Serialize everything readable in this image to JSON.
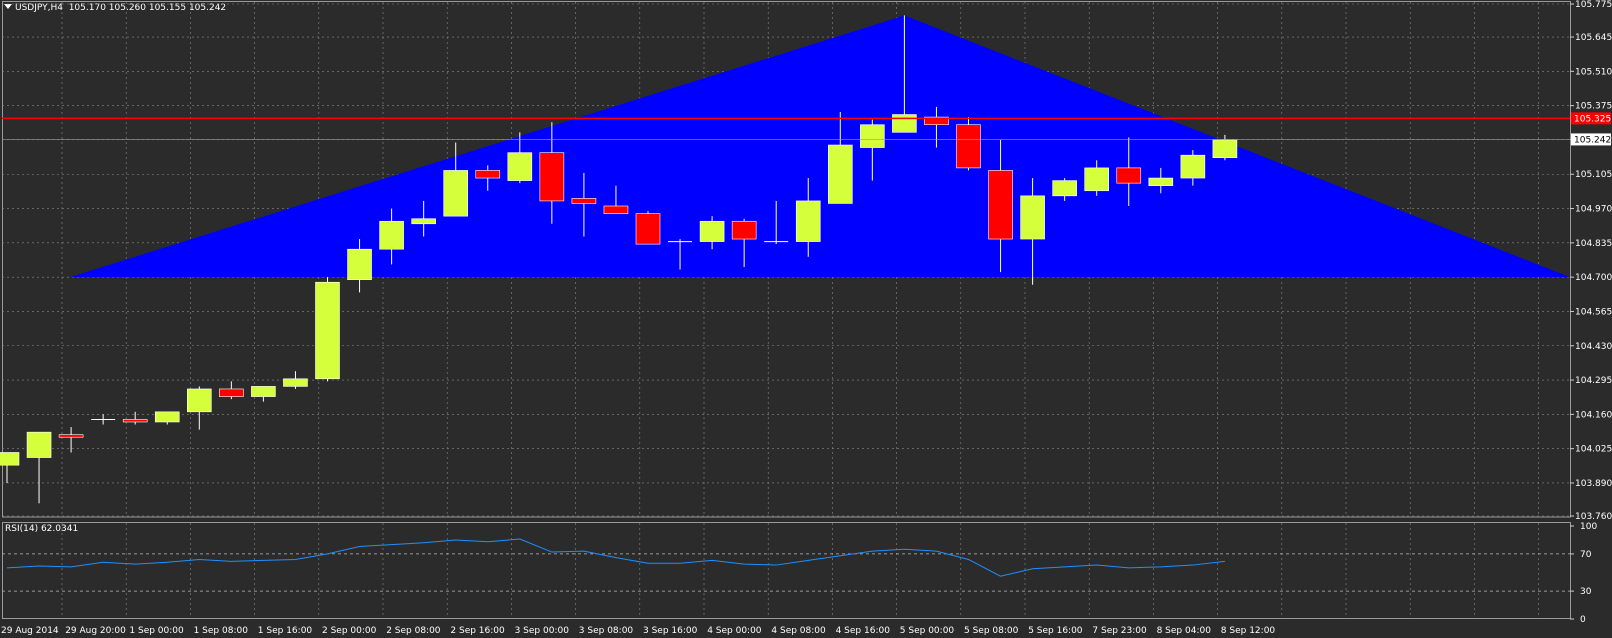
{
  "header": {
    "symbol": "USDJPY,H4",
    "ohlc": "105.170 105.260 105.155 105.242"
  },
  "rsi_header": {
    "label": "RSI(14) 62.0341"
  },
  "colors": {
    "background": "#2b2b2b",
    "grid": "#8a8a8a",
    "bull_candle": "#d4ff3a",
    "bear_candle": "#ff0000",
    "wick": "#ffffff",
    "triangle": "#0000ff",
    "hline": "#ff0000",
    "rsi_line": "#1e90ff",
    "current_price_box": "#ffffff"
  },
  "chart_data": [
    {
      "type": "candlestick",
      "title": "USDJPY,H4",
      "x": [
        "29 Aug 2014",
        "29 Aug 20:00",
        "1 Sep 00:00",
        "1 Sep 08:00",
        "1 Sep 16:00",
        "2 Sep 00:00",
        "2 Sep 08:00",
        "2 Sep 16:00",
        "3 Sep 00:00",
        "3 Sep 08:00",
        "3 Sep 16:00",
        "4 Sep 00:00",
        "4 Sep 08:00",
        "4 Sep 16:00",
        "5 Sep 00:00",
        "5 Sep 08:00",
        "5 Sep 16:00",
        "7 Sep 23:00",
        "8 Sep 04:00",
        "8 Sep 12:00"
      ],
      "y_ticks": [
        "105.775",
        "105.645",
        "105.510",
        "105.375",
        "105.242",
        "105.105",
        "104.970",
        "104.835",
        "104.700",
        "104.565",
        "104.430",
        "104.295",
        "104.160",
        "104.025",
        "103.890",
        "103.760"
      ],
      "ylim": [
        103.76,
        105.775
      ],
      "grid": true,
      "candles": [
        {
          "o": 103.96,
          "h": 103.99,
          "l": 103.89,
          "c": 104.01
        },
        {
          "o": 103.99,
          "h": 104.09,
          "l": 103.81,
          "c": 104.09
        },
        {
          "o": 104.08,
          "h": 104.11,
          "l": 104.01,
          "c": 104.07
        },
        {
          "o": 104.14,
          "h": 104.16,
          "l": 104.12,
          "c": 104.14
        },
        {
          "o": 104.14,
          "h": 104.17,
          "l": 104.12,
          "c": 104.13
        },
        {
          "o": 104.13,
          "h": 104.17,
          "l": 104.12,
          "c": 104.17
        },
        {
          "o": 104.17,
          "h": 104.27,
          "l": 104.1,
          "c": 104.26
        },
        {
          "o": 104.26,
          "h": 104.29,
          "l": 104.22,
          "c": 104.23
        },
        {
          "o": 104.23,
          "h": 104.27,
          "l": 104.21,
          "c": 104.27
        },
        {
          "o": 104.27,
          "h": 104.33,
          "l": 104.26,
          "c": 104.3
        },
        {
          "o": 104.3,
          "h": 104.7,
          "l": 104.29,
          "c": 104.68
        },
        {
          "o": 104.69,
          "h": 104.85,
          "l": 104.64,
          "c": 104.81
        },
        {
          "o": 104.81,
          "h": 104.97,
          "l": 104.75,
          "c": 104.92
        },
        {
          "o": 104.91,
          "h": 105.0,
          "l": 104.86,
          "c": 104.93
        },
        {
          "o": 104.94,
          "h": 105.23,
          "l": 104.94,
          "c": 105.12
        },
        {
          "o": 105.12,
          "h": 105.14,
          "l": 105.04,
          "c": 105.09
        },
        {
          "o": 105.08,
          "h": 105.27,
          "l": 105.07,
          "c": 105.19
        },
        {
          "o": 105.19,
          "h": 105.31,
          "l": 104.91,
          "c": 105.0
        },
        {
          "o": 105.01,
          "h": 105.11,
          "l": 104.86,
          "c": 104.99
        },
        {
          "o": 104.98,
          "h": 105.06,
          "l": 104.95,
          "c": 104.95
        },
        {
          "o": 104.95,
          "h": 104.96,
          "l": 104.84,
          "c": 104.83
        },
        {
          "o": 104.84,
          "h": 104.85,
          "l": 104.73,
          "c": 104.84
        },
        {
          "o": 104.84,
          "h": 104.94,
          "l": 104.81,
          "c": 104.92
        },
        {
          "o": 104.92,
          "h": 104.93,
          "l": 104.74,
          "c": 104.85
        },
        {
          "o": 104.84,
          "h": 105.0,
          "l": 104.83,
          "c": 104.84
        },
        {
          "o": 104.84,
          "h": 105.09,
          "l": 104.78,
          "c": 105.0
        },
        {
          "o": 104.99,
          "h": 105.35,
          "l": 104.99,
          "c": 105.22
        },
        {
          "o": 105.21,
          "h": 105.32,
          "l": 105.08,
          "c": 105.3
        },
        {
          "o": 105.27,
          "h": 105.73,
          "l": 105.27,
          "c": 105.34
        },
        {
          "o": 105.33,
          "h": 105.37,
          "l": 105.21,
          "c": 105.3
        },
        {
          "o": 105.3,
          "h": 105.33,
          "l": 105.12,
          "c": 105.13
        },
        {
          "o": 105.12,
          "h": 105.24,
          "l": 104.72,
          "c": 104.85
        },
        {
          "o": 104.85,
          "h": 105.09,
          "l": 104.67,
          "c": 105.02
        },
        {
          "o": 105.02,
          "h": 105.09,
          "l": 105.0,
          "c": 105.08
        },
        {
          "o": 105.04,
          "h": 105.16,
          "l": 105.02,
          "c": 105.13
        },
        {
          "o": 105.13,
          "h": 105.25,
          "l": 104.98,
          "c": 105.07
        },
        {
          "o": 105.06,
          "h": 105.13,
          "l": 105.03,
          "c": 105.09
        },
        {
          "o": 105.09,
          "h": 105.2,
          "l": 105.06,
          "c": 105.18
        },
        {
          "o": 105.17,
          "h": 105.26,
          "l": 105.16,
          "c": 105.24
        }
      ],
      "annotations": {
        "triangle": {
          "base_price": 104.7,
          "apex_price": 105.73,
          "apex_candle": 28
        },
        "horizontal_line": {
          "price": 105.325,
          "label": "105.325"
        },
        "current_price": {
          "price": 105.242,
          "label": "105.242"
        }
      }
    },
    {
      "type": "line",
      "title": "RSI(14) 62.0341",
      "y_ticks": [
        "100",
        "70",
        "30",
        "0"
      ],
      "ylim": [
        0,
        100
      ],
      "levels": [
        70,
        30
      ],
      "values": [
        55,
        57,
        56,
        61,
        59,
        61,
        64,
        62,
        63,
        64,
        70,
        78,
        80,
        82,
        85,
        83,
        86,
        72,
        73,
        66,
        60,
        60,
        63,
        59,
        58,
        63,
        68,
        73,
        75,
        73,
        64,
        46,
        54,
        56,
        58,
        55,
        56,
        58,
        62
      ]
    }
  ]
}
